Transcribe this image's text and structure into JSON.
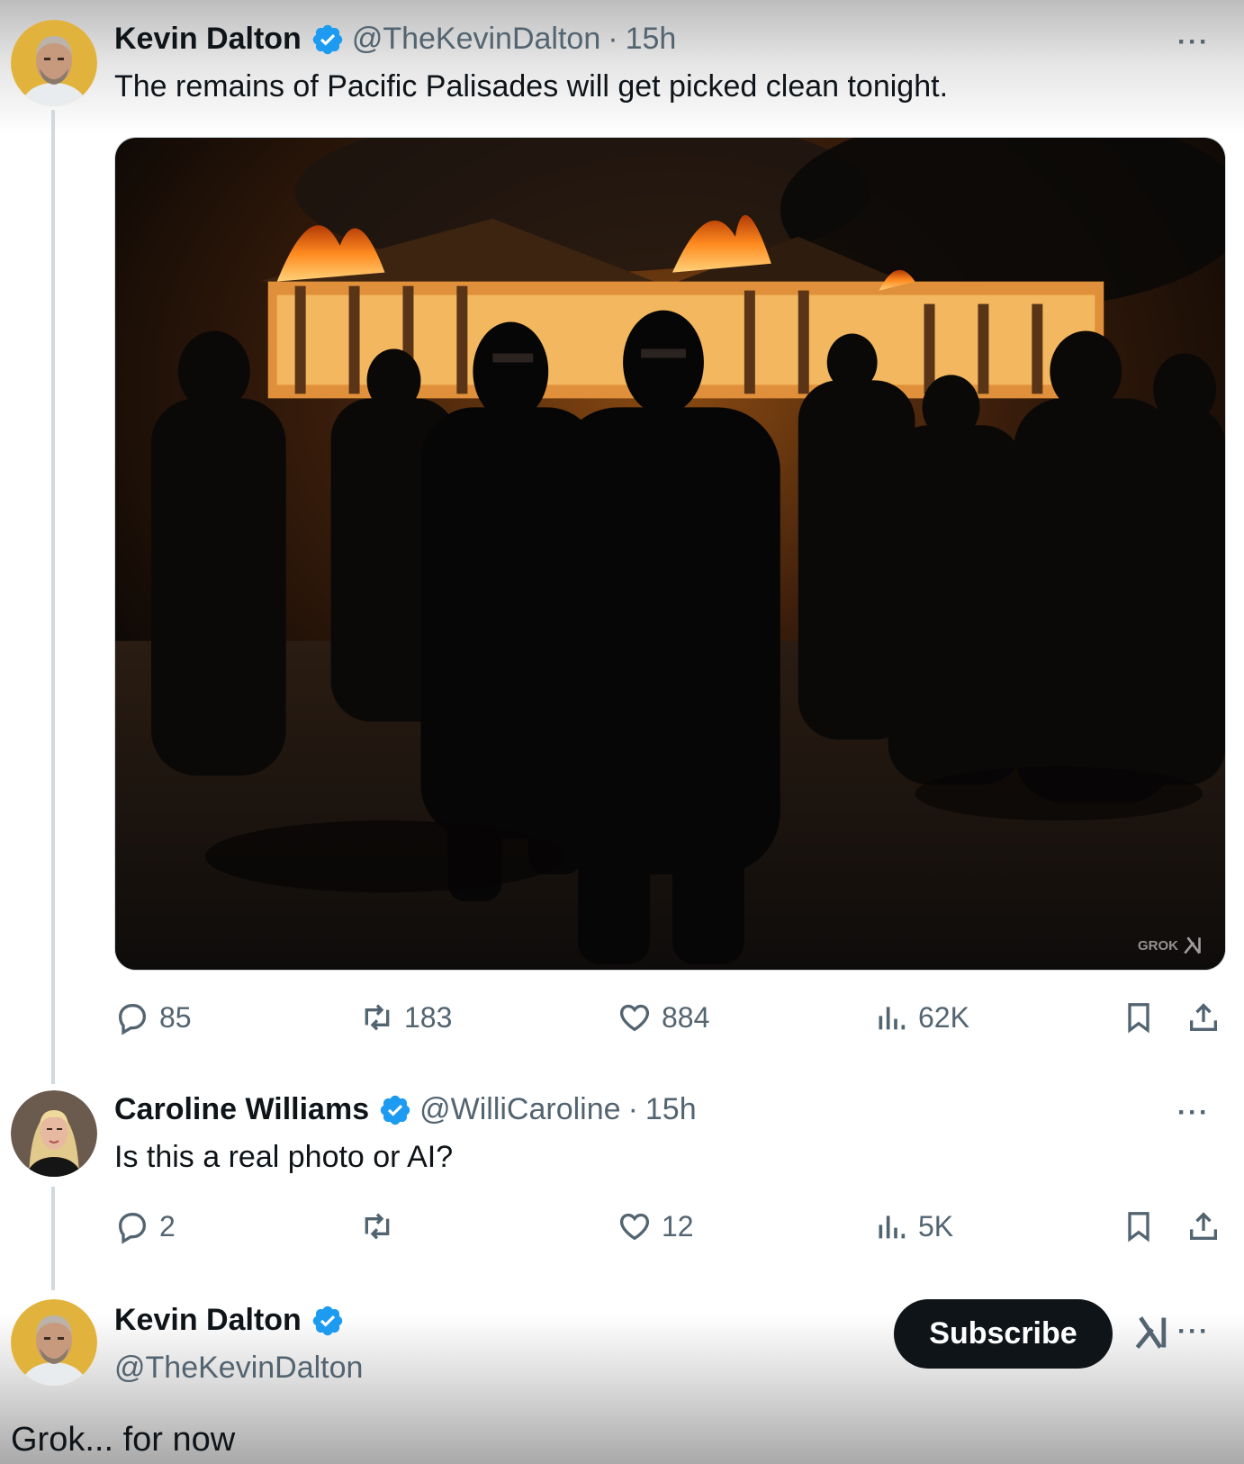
{
  "tweet1": {
    "display_name": "Kevin Dalton",
    "handle": "@TheKevinDalton",
    "separator": "·",
    "time": "15h",
    "text": "The remains of Pacific Palisades will get picked clean tonight.",
    "more": "···",
    "media_watermark": "GROK",
    "media_alt_icon": "grok-logo-icon",
    "stats": {
      "replies": "85",
      "reposts": "183",
      "likes": "884",
      "views": "62K"
    }
  },
  "tweet2": {
    "display_name": "Caroline Williams",
    "handle": "@WilliCaroline",
    "separator": "·",
    "time": "15h",
    "text": "Is this a real photo or AI?",
    "more": "···",
    "stats": {
      "replies": "2",
      "reposts": "",
      "likes": "12",
      "views": "5K"
    }
  },
  "tweet3": {
    "display_name": "Kevin Dalton",
    "handle": "@TheKevinDalton",
    "subscribe_label": "Subscribe",
    "more": "···",
    "text": "Grok... for now"
  },
  "colors": {
    "text_primary": "#0f1419",
    "text_secondary": "#536471",
    "verified_blue": "#1d9bf0",
    "subscribe_bg": "#0f1419"
  },
  "icons": [
    "reply-icon",
    "repost-icon",
    "like-icon",
    "views-icon",
    "bookmark-icon",
    "share-icon",
    "verified-badge-icon",
    "grok-logo-icon"
  ]
}
